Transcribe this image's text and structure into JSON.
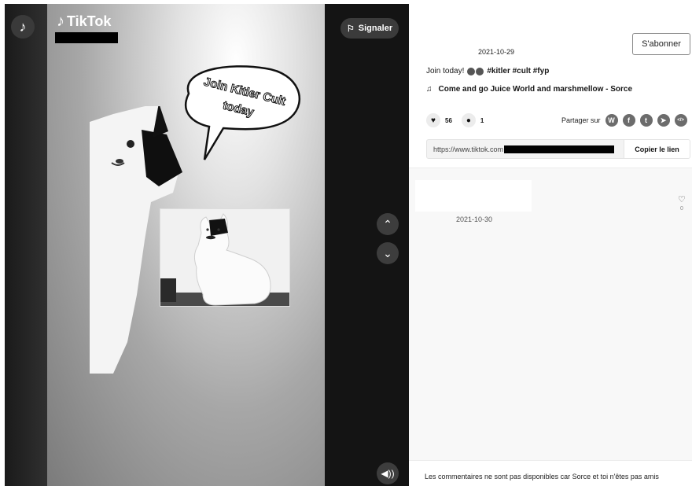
{
  "header": {
    "logo_text": "TikTok",
    "badge_glyph": "♪",
    "report_label": "Signaler"
  },
  "video": {
    "bubble_line1": "Join Kitler Cult",
    "bubble_line2": "today"
  },
  "controls": {
    "up_glyph": "⌃",
    "down_glyph": "⌄",
    "volume_glyph": "◀))"
  },
  "post": {
    "date": "2021-10-29",
    "subscribe_label": "S'abonner",
    "caption_text": "Join today!",
    "hashtags": "#kitler #cult #fyp",
    "music_glyph": "♫",
    "music": "Come and go Juice World and marshmellow - Sorce",
    "likes": "56",
    "comments": "1",
    "share_label": "Partager sur",
    "link_url": "https://www.tiktok.com",
    "copy_label": "Copier le lien"
  },
  "share_icons": [
    {
      "name": "whatsapp-icon",
      "glyph": "W"
    },
    {
      "name": "facebook-icon",
      "glyph": "f"
    },
    {
      "name": "twitter-icon",
      "glyph": "t"
    },
    {
      "name": "telegram-icon",
      "glyph": "➤"
    },
    {
      "name": "embed-icon",
      "glyph": "</>"
    }
  ],
  "comment": {
    "date": "2021-10-30",
    "like_count": "0"
  },
  "footer": {
    "notice": "Les commentaires ne sont pas disponibles car Sorce et toi n'êtes pas amis"
  },
  "colors": {
    "panel_bg": "#ffffff",
    "video_bg": "#161616"
  }
}
